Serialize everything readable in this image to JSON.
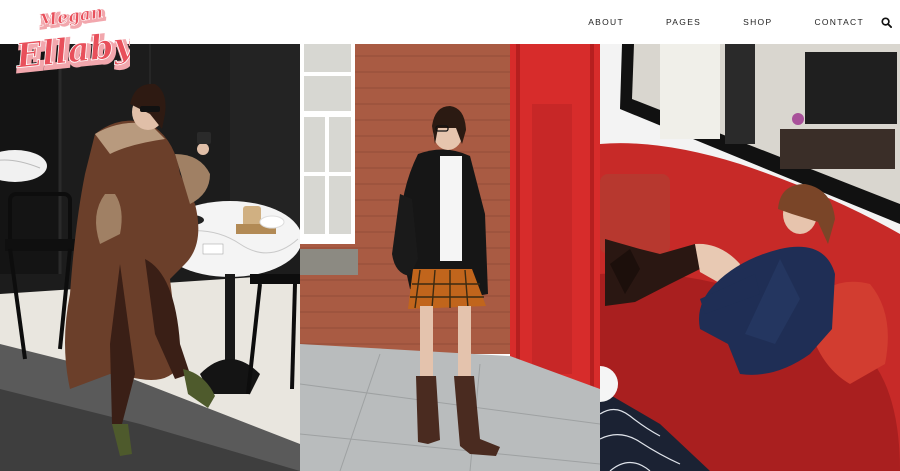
{
  "brand": {
    "logo_small": "Megan",
    "logo_big": "Ellaby",
    "color_main": "#e8505b",
    "color_shadow": "#f2a7ad"
  },
  "nav": {
    "items": [
      {
        "label": "ABOUT"
      },
      {
        "label": "PAGES"
      },
      {
        "label": "SHOP"
      },
      {
        "label": "CONTACT"
      }
    ],
    "search_icon": "search-icon"
  },
  "gallery": {
    "photos": [
      {
        "subject": "woman in brown shearling coat at cafe table"
      },
      {
        "subject": "woman in black blazer and plaid skirt by brick wall"
      },
      {
        "subject": "woman in denim on red sofa"
      }
    ]
  }
}
